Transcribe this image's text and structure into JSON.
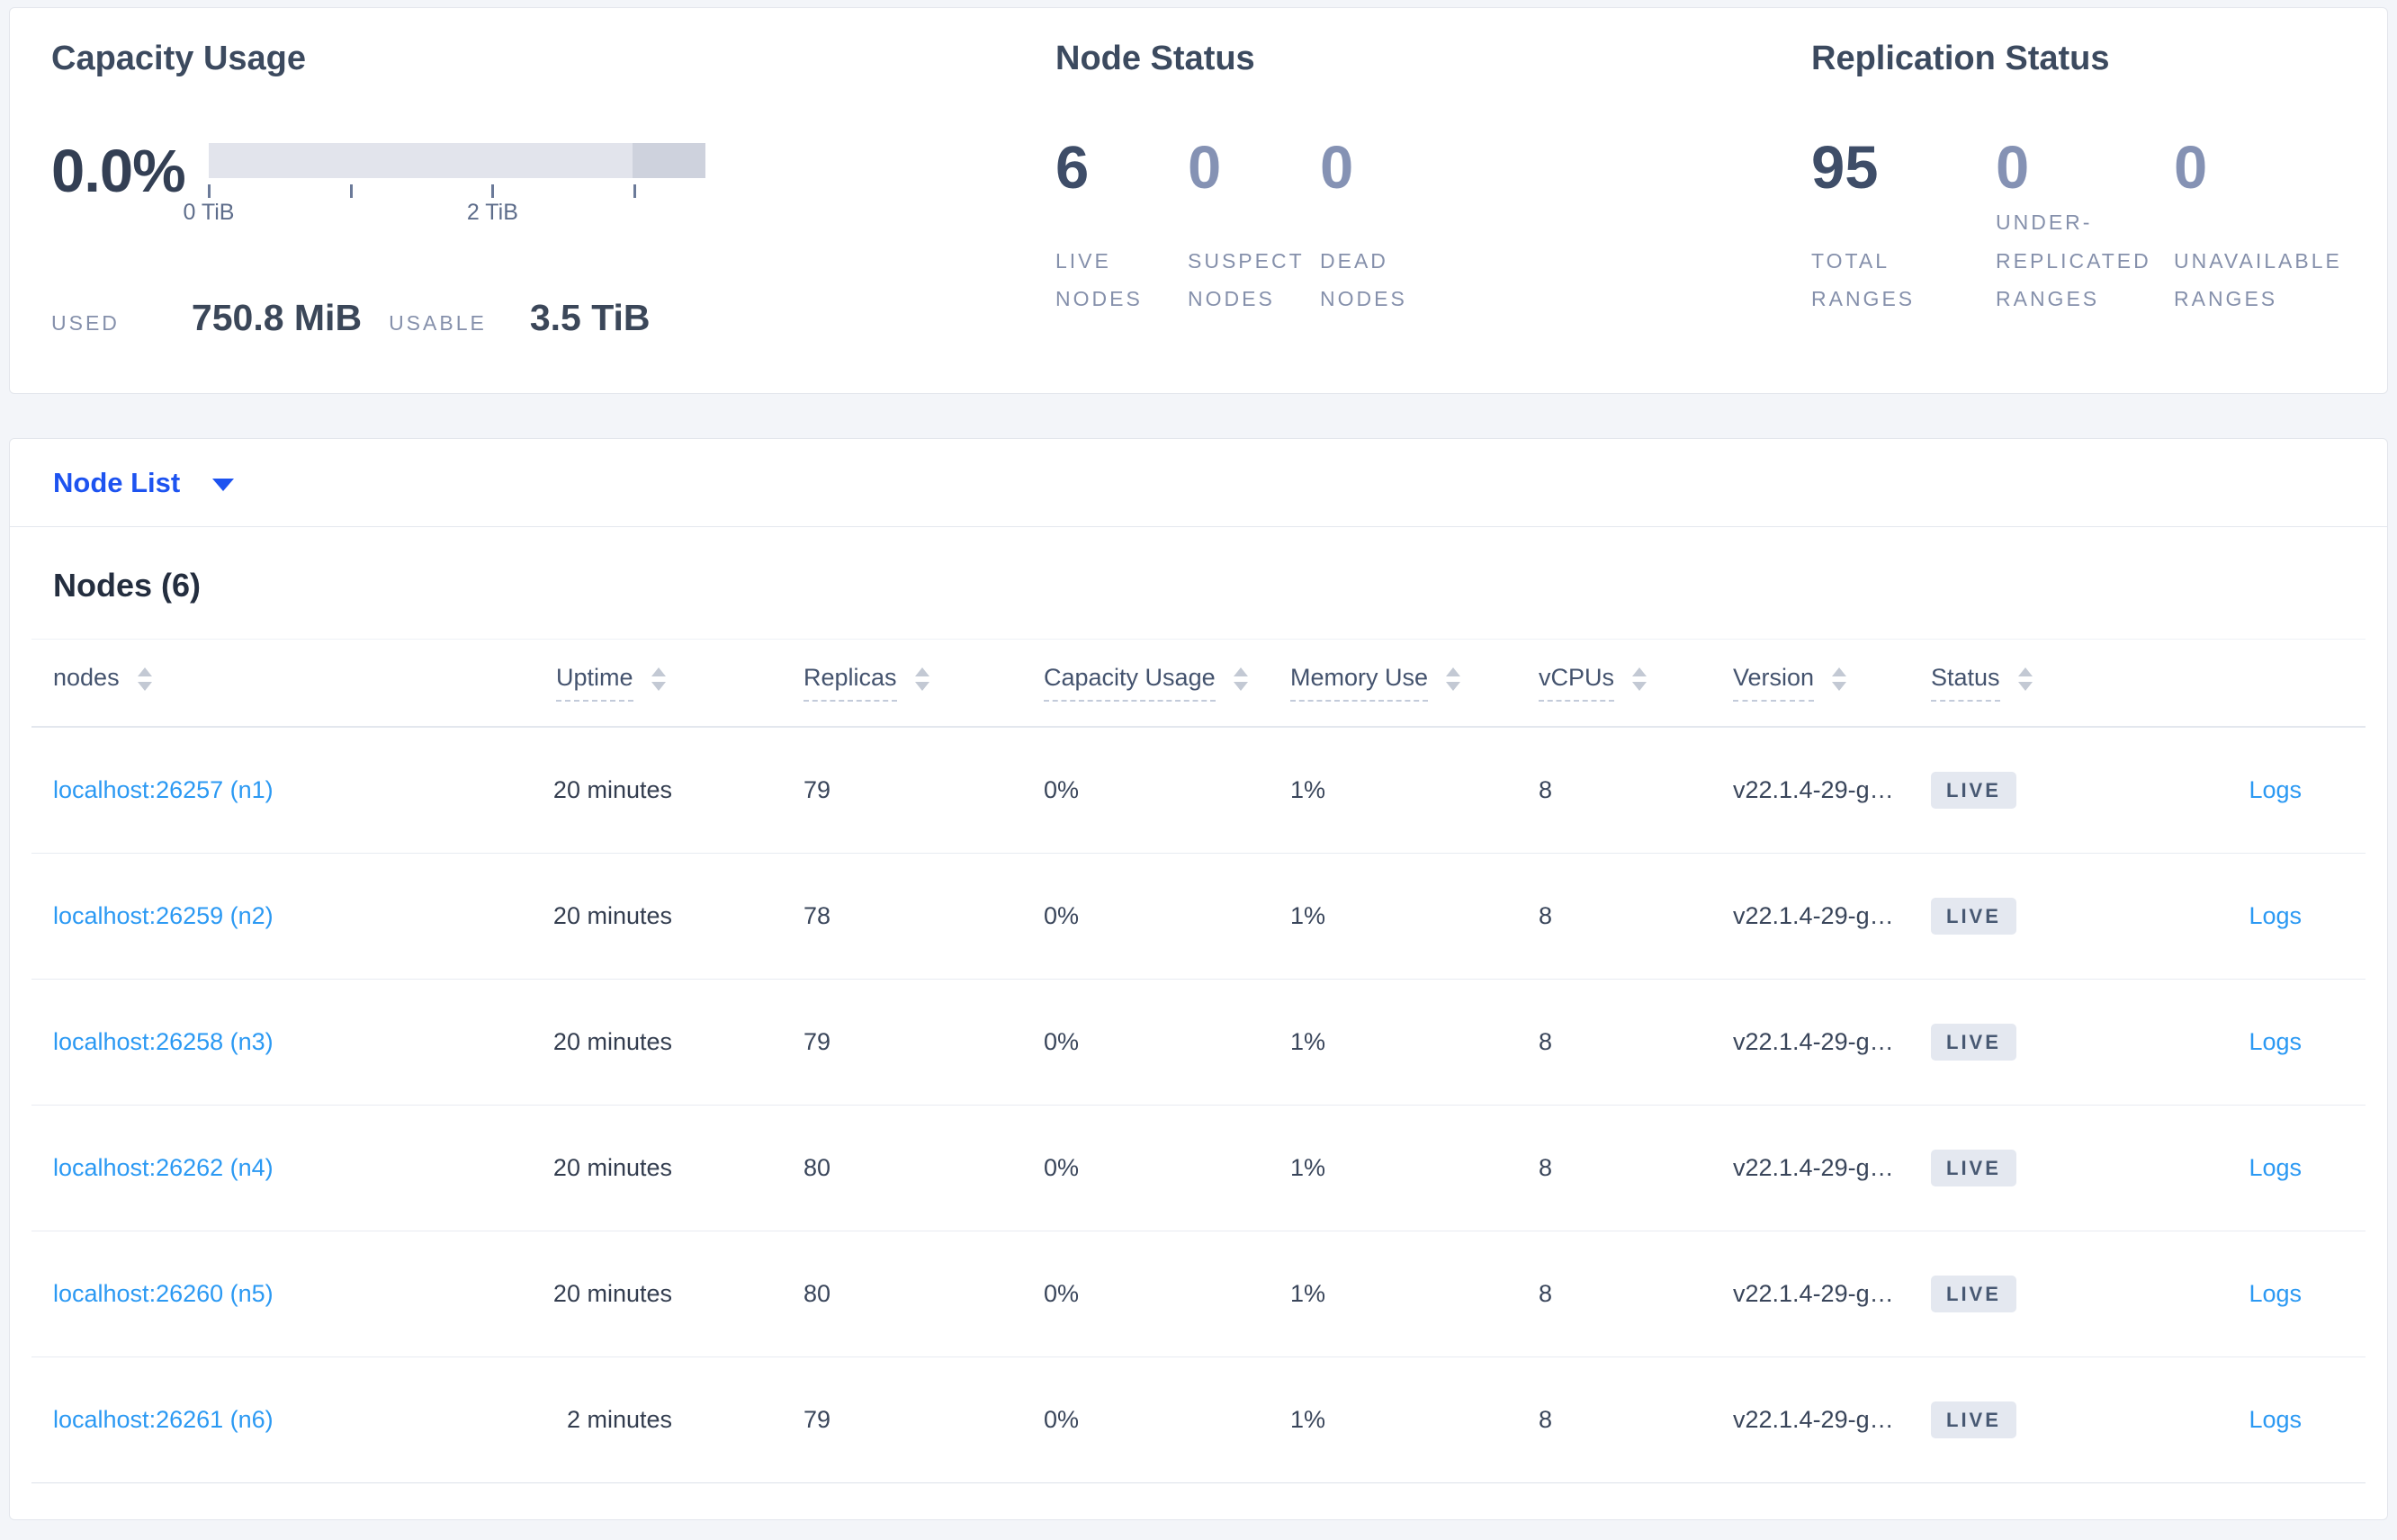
{
  "colors": {
    "page_background": "#f3f5f9",
    "panel_background": "#ffffff",
    "accent_blue": "#1d53f0",
    "link_blue": "#2b99f3",
    "dark_slate": "#394455",
    "muted_number": "#8592b4",
    "label_gray": "#8590ab",
    "bar_light": "#e2e4ec",
    "bar_dark": "#ced2dd",
    "badge_background": "#e4e8f0"
  },
  "overview": {
    "capacity": {
      "title": "Capacity Usage",
      "percent": "0.0%",
      "tick_label_0": "0 TiB",
      "tick_label_2": "2 TiB",
      "used_label": "USED",
      "used_value": "750.8 MiB",
      "usable_label": "USABLE",
      "usable_value": "3.5 TiB"
    },
    "node_status": {
      "title": "Node Status",
      "stats": [
        {
          "value": "6",
          "label": "LIVE\nNODES"
        },
        {
          "value": "0",
          "label": "SUSPECT\nNODES"
        },
        {
          "value": "0",
          "label": "DEAD\nNODES"
        }
      ]
    },
    "replication_status": {
      "title": "Replication Status",
      "stats": [
        {
          "value": "95",
          "label": "TOTAL\nRANGES"
        },
        {
          "value": "0",
          "label": "UNDER-\nREPLICATED\nRANGES"
        },
        {
          "value": "0",
          "label": "UNAVAILABLE\nRANGES"
        }
      ]
    }
  },
  "node_list": {
    "label": "Node List"
  },
  "table": {
    "title": "Nodes (6)",
    "columns": [
      {
        "label": "nodes"
      },
      {
        "label": "Uptime"
      },
      {
        "label": "Replicas"
      },
      {
        "label": "Capacity Usage"
      },
      {
        "label": "Memory Use"
      },
      {
        "label": "vCPUs"
      },
      {
        "label": "Version"
      },
      {
        "label": "Status"
      }
    ],
    "rows": [
      {
        "address": "localhost:26257 (n1)",
        "uptime": "20 minutes",
        "replicas": "79",
        "capacity": "0%",
        "memory": "1%",
        "vcpus": "8",
        "version": "v22.1.4-29-g…",
        "status": "LIVE",
        "logs_label": "Logs"
      },
      {
        "address": "localhost:26259 (n2)",
        "uptime": "20 minutes",
        "replicas": "78",
        "capacity": "0%",
        "memory": "1%",
        "vcpus": "8",
        "version": "v22.1.4-29-g…",
        "status": "LIVE",
        "logs_label": "Logs"
      },
      {
        "address": "localhost:26258 (n3)",
        "uptime": "20 minutes",
        "replicas": "79",
        "capacity": "0%",
        "memory": "1%",
        "vcpus": "8",
        "version": "v22.1.4-29-g…",
        "status": "LIVE",
        "logs_label": "Logs"
      },
      {
        "address": "localhost:26262 (n4)",
        "uptime": "20 minutes",
        "replicas": "80",
        "capacity": "0%",
        "memory": "1%",
        "vcpus": "8",
        "version": "v22.1.4-29-g…",
        "status": "LIVE",
        "logs_label": "Logs"
      },
      {
        "address": "localhost:26260 (n5)",
        "uptime": "20 minutes",
        "replicas": "80",
        "capacity": "0%",
        "memory": "1%",
        "vcpus": "8",
        "version": "v22.1.4-29-g…",
        "status": "LIVE",
        "logs_label": "Logs"
      },
      {
        "address": "localhost:26261 (n6)",
        "uptime": "2 minutes",
        "replicas": "79",
        "capacity": "0%",
        "memory": "1%",
        "vcpus": "8",
        "version": "v22.1.4-29-g…",
        "status": "LIVE",
        "logs_label": "Logs"
      }
    ]
  }
}
